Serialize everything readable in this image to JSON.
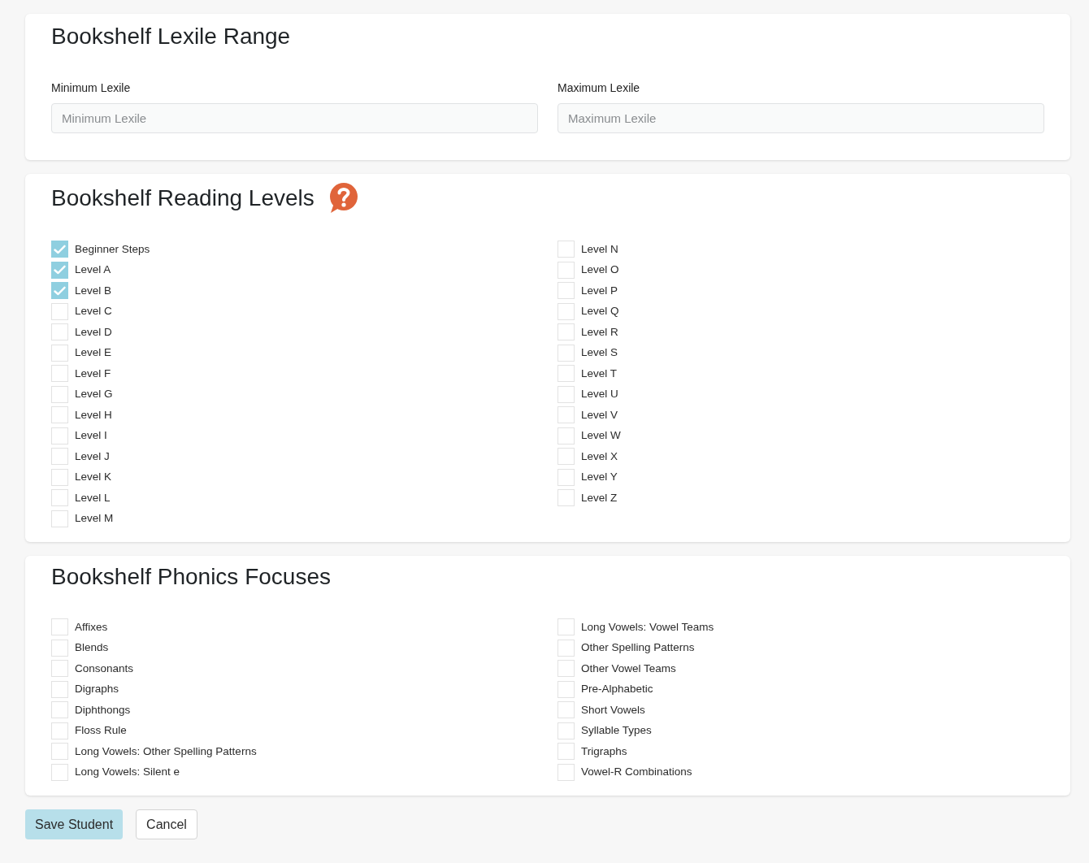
{
  "sections": [
    {
      "kind": "range",
      "title": "Bookshelf Lexile Range",
      "fields": [
        {
          "label": "Minimum Lexile",
          "placeholder": "Minimum Lexile"
        },
        {
          "label": "Maximum Lexile",
          "placeholder": "Maximum Lexile"
        }
      ]
    },
    {
      "kind": "checklist",
      "title": "Bookshelf Reading Levels",
      "help_icon": true,
      "columns": [
        [
          {
            "label": "Beginner Steps",
            "checked": true
          },
          {
            "label": "Level A",
            "checked": true
          },
          {
            "label": "Level B",
            "checked": true
          },
          {
            "label": "Level C",
            "checked": false
          },
          {
            "label": "Level D",
            "checked": false
          },
          {
            "label": "Level E",
            "checked": false
          },
          {
            "label": "Level F",
            "checked": false
          },
          {
            "label": "Level G",
            "checked": false
          },
          {
            "label": "Level H",
            "checked": false
          },
          {
            "label": "Level I",
            "checked": false
          },
          {
            "label": "Level J",
            "checked": false
          },
          {
            "label": "Level K",
            "checked": false
          },
          {
            "label": "Level L",
            "checked": false
          },
          {
            "label": "Level M",
            "checked": false
          }
        ],
        [
          {
            "label": "Level N",
            "checked": false
          },
          {
            "label": "Level O",
            "checked": false
          },
          {
            "label": "Level P",
            "checked": false
          },
          {
            "label": "Level Q",
            "checked": false
          },
          {
            "label": "Level R",
            "checked": false
          },
          {
            "label": "Level S",
            "checked": false
          },
          {
            "label": "Level T",
            "checked": false
          },
          {
            "label": "Level U",
            "checked": false
          },
          {
            "label": "Level V",
            "checked": false
          },
          {
            "label": "Level W",
            "checked": false
          },
          {
            "label": "Level X",
            "checked": false
          },
          {
            "label": "Level Y",
            "checked": false
          },
          {
            "label": "Level Z",
            "checked": false
          }
        ]
      ]
    },
    {
      "kind": "checklist",
      "title": "Bookshelf Phonics Focuses",
      "columns": [
        [
          {
            "label": "Affixes",
            "checked": false
          },
          {
            "label": "Blends",
            "checked": false
          },
          {
            "label": "Consonants",
            "checked": false
          },
          {
            "label": "Digraphs",
            "checked": false
          },
          {
            "label": "Diphthongs",
            "checked": false
          },
          {
            "label": "Floss Rule",
            "checked": false
          },
          {
            "label": "Long Vowels: Other Spelling Patterns",
            "checked": false
          },
          {
            "label": "Long Vowels: Silent e",
            "checked": false
          }
        ],
        [
          {
            "label": "Long Vowels: Vowel Teams",
            "checked": false
          },
          {
            "label": "Other Spelling Patterns",
            "checked": false
          },
          {
            "label": "Other Vowel Teams",
            "checked": false
          },
          {
            "label": "Pre-Alphabetic",
            "checked": false
          },
          {
            "label": "Short Vowels",
            "checked": false
          },
          {
            "label": "Syllable Types",
            "checked": false
          },
          {
            "label": "Trigraphs",
            "checked": false
          },
          {
            "label": "Vowel-R Combinations",
            "checked": false
          }
        ]
      ]
    }
  ],
  "buttons": [
    {
      "label": "Save Student",
      "kind": "primary"
    },
    {
      "label": "Cancel",
      "kind": "secondary"
    }
  ]
}
